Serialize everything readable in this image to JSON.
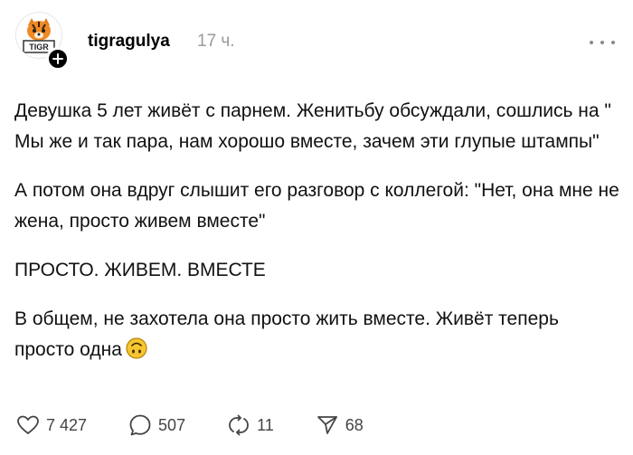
{
  "author": {
    "username": "tigragulya",
    "time_ago": "17 ч.",
    "avatar_text": "TIGR",
    "avatar_icon": "tiger-avatar",
    "follow_icon": "plus-icon"
  },
  "post": {
    "paragraphs": [
      "Девушка 5 лет живёт с парнем. Женитьбу обсуждали, сошлись на \" Мы же и так пара, нам хорошо вместе, зачем эти глупые штампы\"",
      "А потом она вдруг слышит его разговор с коллегой: \"Нет, она мне не жена, просто живем вместе\"",
      "ПРОСТО. ЖИВЕМ. ВМЕСТЕ"
    ],
    "last_paragraph": "В общем, не захотела она просто жить вместе. Живёт теперь просто одна",
    "emoji": "upside-down-face-emoji"
  },
  "actions": {
    "likes": "7 427",
    "comments": "507",
    "reposts": "11",
    "shares": "68"
  },
  "colors": {
    "text": "#111111",
    "muted": "#9a9a9a",
    "icon": "#444444",
    "emoji": "#f7c531"
  }
}
